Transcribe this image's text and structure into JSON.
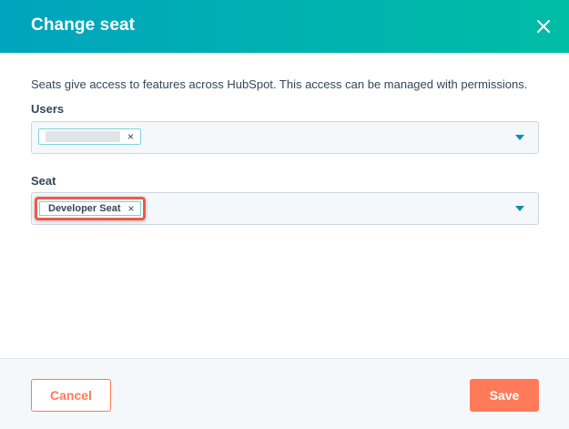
{
  "modal": {
    "title": "Change seat",
    "description": "Seats give access to features across HubSpot. This access can be managed with permissions."
  },
  "users": {
    "label": "Users",
    "remove_symbol": "×"
  },
  "seat": {
    "label": "Seat",
    "selected_value": "Developer Seat",
    "remove_symbol": "×"
  },
  "footer": {
    "cancel_label": "Cancel",
    "save_label": "Save"
  },
  "colors": {
    "header_gradient_start": "#00a4bd",
    "header_gradient_end": "#00bda5",
    "accent": "#ff7a59",
    "highlight": "#ea5b4b",
    "text": "#33475b"
  },
  "icons": {
    "close": "close-icon",
    "dropdown": "caret-down-icon"
  }
}
